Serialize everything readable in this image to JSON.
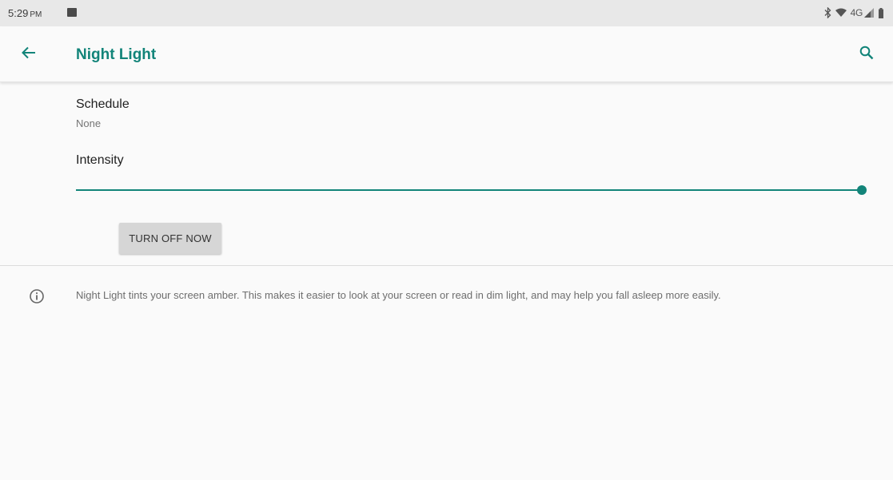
{
  "status_bar": {
    "time": "5:29",
    "ampm": "PM",
    "network": "4G"
  },
  "app_bar": {
    "title": "Night Light"
  },
  "schedule": {
    "title": "Schedule",
    "value": "None"
  },
  "intensity": {
    "label": "Intensity",
    "level": 1.0
  },
  "turn_off_button": {
    "label": "TURN OFF NOW"
  },
  "info": {
    "text": "Night Light tints your screen amber. This makes it easier to look at your screen or read in dim light, and may help you fall asleep more easily."
  },
  "icons": {
    "back": "arrow-back-icon",
    "search": "search-icon",
    "info": "info-icon",
    "bluetooth": "bluetooth-icon",
    "wifi": "wifi-icon",
    "signal": "cell-signal-icon",
    "battery": "battery-icon",
    "notification": "image-notification-icon"
  },
  "colors": {
    "accent": "#128479",
    "status_bar": "#e8e8e8",
    "background": "#fafafa"
  }
}
